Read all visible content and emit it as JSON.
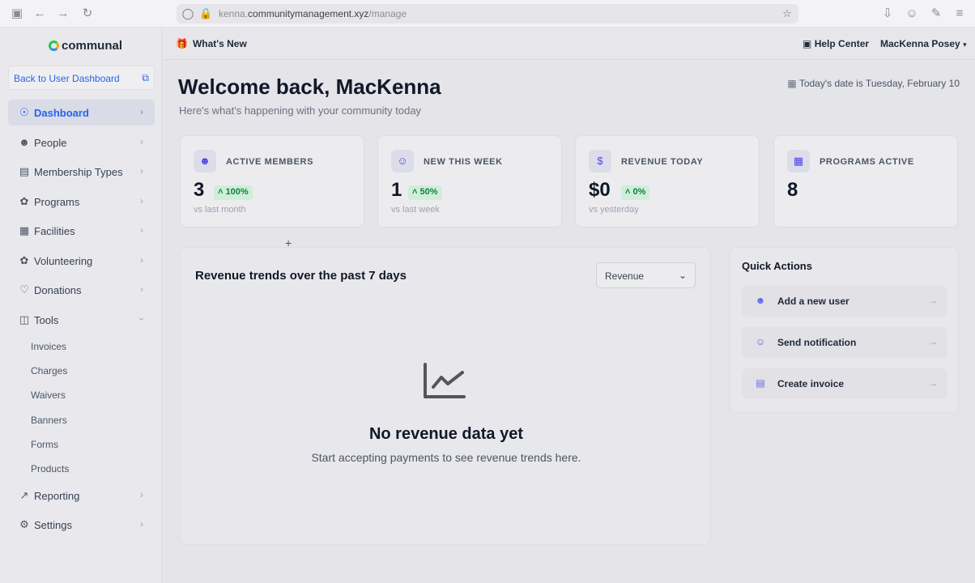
{
  "browser": {
    "url_domain_prefix": "kenna.",
    "url_domain": "communitymanagement.xyz",
    "url_path": "/manage"
  },
  "app": {
    "logo": "communal"
  },
  "sidebar": {
    "back_link": "Back to User Dashboard",
    "items": [
      {
        "label": "Dashboard",
        "icon": "dashboard-icon",
        "active": true
      },
      {
        "label": "People",
        "icon": "person-icon"
      },
      {
        "label": "Membership Types",
        "icon": "id-card-icon"
      },
      {
        "label": "Programs",
        "icon": "running-icon"
      },
      {
        "label": "Facilities",
        "icon": "building-icon"
      },
      {
        "label": "Volunteering",
        "icon": "handshake-icon"
      },
      {
        "label": "Donations",
        "icon": "heart-hand-icon"
      },
      {
        "label": "Tools",
        "icon": "toolbox-icon",
        "expanded": true
      },
      {
        "label": "Reporting",
        "icon": "chart-icon"
      },
      {
        "label": "Settings",
        "icon": "gear-icon"
      }
    ],
    "tools_sub": [
      "Invoices",
      "Charges",
      "Waivers",
      "Banners",
      "Forms",
      "Products"
    ]
  },
  "topbar": {
    "whats_new": "What's New",
    "help_center": "Help Center",
    "user_name": "MacKenna Posey"
  },
  "main": {
    "welcome": "Welcome back, MacKenna",
    "subtitle": "Here's what's happening with your community today",
    "today": "Today's date is Tuesday, February 10"
  },
  "stats": [
    {
      "title": "ACTIVE MEMBERS",
      "value": "3",
      "badge": "100%",
      "sub": "vs last month"
    },
    {
      "title": "NEW THIS WEEK",
      "value": "1",
      "badge": "50%",
      "sub": "vs last week"
    },
    {
      "title": "REVENUE TODAY",
      "value": "$0",
      "badge": "0%",
      "sub": "vs yesterday"
    },
    {
      "title": "PROGRAMS ACTIVE",
      "value": "8"
    }
  ],
  "revenue_chart": {
    "title": "Revenue trends over the past 7 days",
    "select_value": "Revenue",
    "empty_title": "No revenue data yet",
    "empty_sub": "Start accepting payments to see revenue trends here."
  },
  "quick_actions": {
    "title": "Quick Actions",
    "items": [
      {
        "label": "Add a new user"
      },
      {
        "label": "Send notification"
      },
      {
        "label": "Create invoice"
      }
    ]
  },
  "colors": {
    "accent": "#2563eb",
    "badge_green": "#15803d"
  }
}
